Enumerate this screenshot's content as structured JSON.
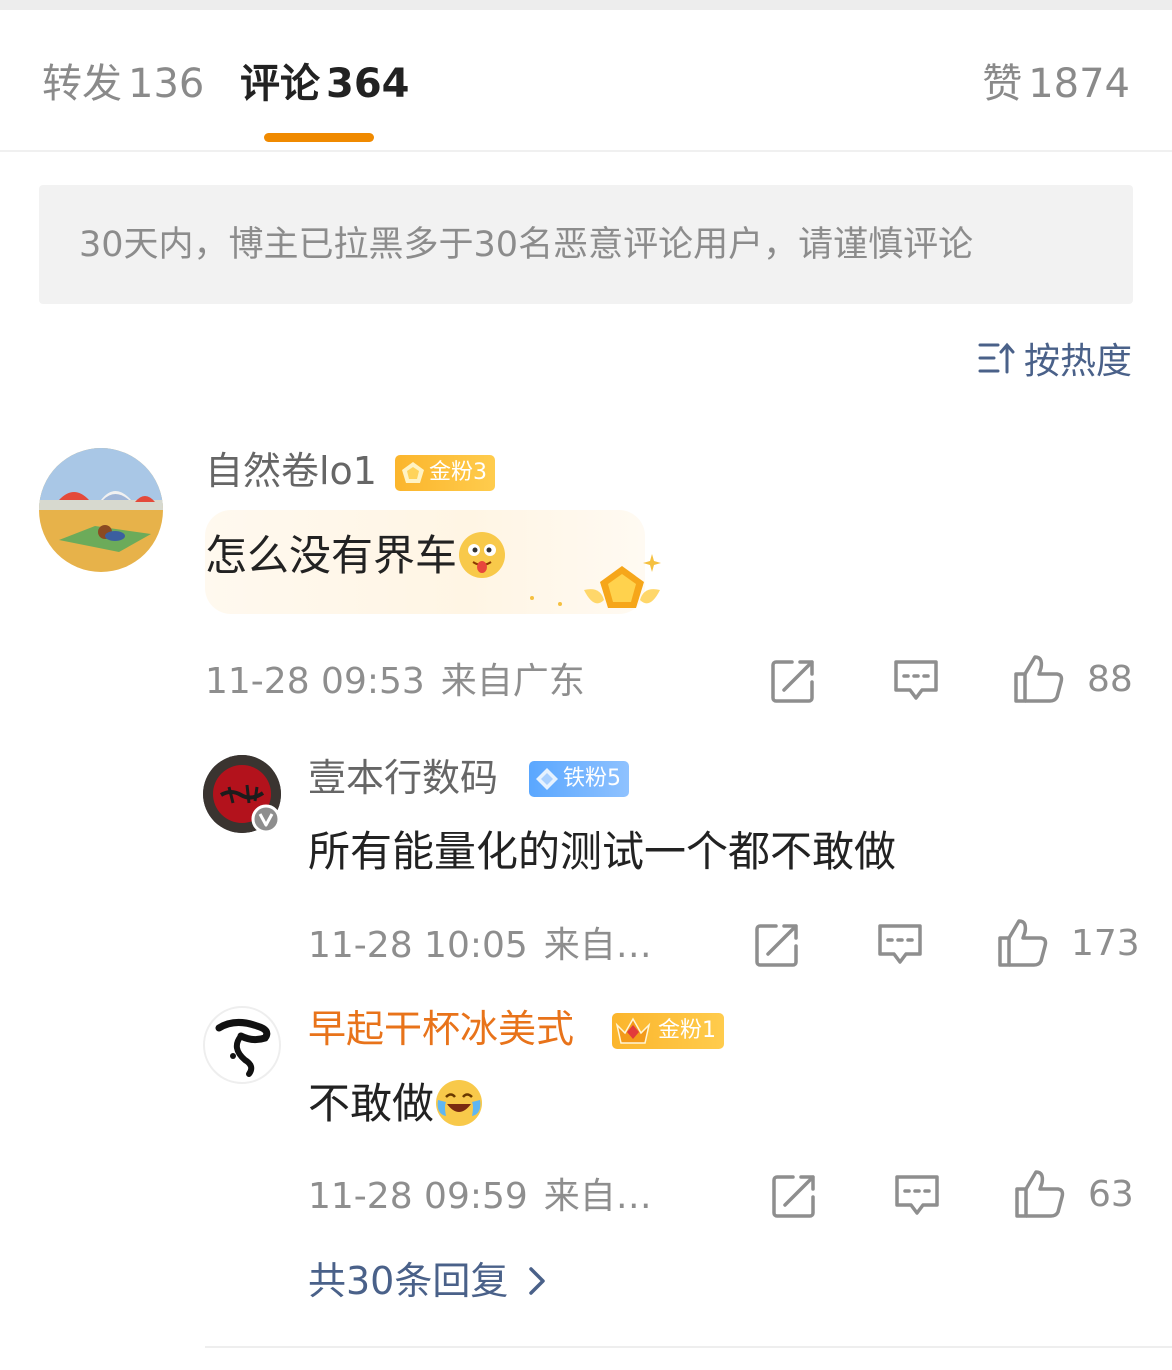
{
  "tabs": {
    "reposts_label": "转发",
    "reposts_count": "136",
    "comments_label": "评论",
    "comments_count": "364",
    "likes_label": "赞",
    "likes_count": "1874"
  },
  "notice": "30天内，博主已拉黑多于30名恶意评论用户，请谨慎评论",
  "sort_label": "按热度",
  "comments": [
    {
      "user": "自然卷lo1",
      "badge": "金粉3",
      "text": "怎么没有界车",
      "time": "11-28 09:53",
      "location": "来自广东",
      "likes": "88"
    }
  ],
  "replies": [
    {
      "user": "壹本行数码",
      "badge": "铁粉5",
      "text": "所有能量化的测试一个都不敢做",
      "time": "11-28 10:05",
      "location": "来自…",
      "likes": "173"
    },
    {
      "user": "早起干杯冰美式",
      "badge": "金粉1",
      "text": "不敢做",
      "time": "11-28 09:59",
      "location": "来自…",
      "likes": "63",
      "name_color": "#e8731a"
    }
  ],
  "more_replies": "共30条回复",
  "colors": {
    "accent": "#f08a00",
    "link": "#4a6189",
    "muted": "#8e8e8e"
  }
}
